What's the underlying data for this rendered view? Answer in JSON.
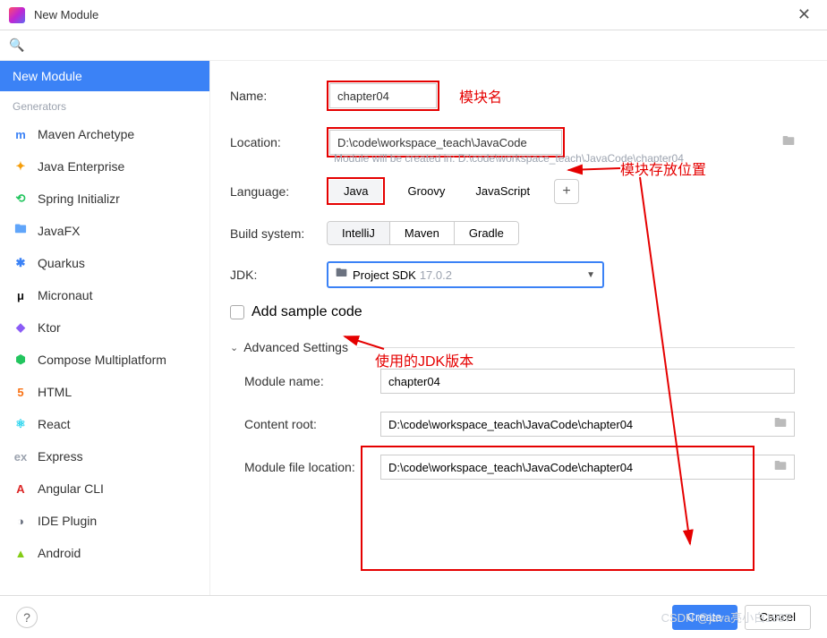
{
  "title": "New Module",
  "sidebar": {
    "new_module": "New Module",
    "generators_hdr": "Generators",
    "items": [
      {
        "label": "Maven Archetype",
        "color": "#3b82f6",
        "glyph": "m"
      },
      {
        "label": "Java Enterprise",
        "color": "#f59e0b",
        "glyph": "✦"
      },
      {
        "label": "Spring Initializr",
        "color": "#22c55e",
        "glyph": "⟲"
      },
      {
        "label": "JavaFX",
        "color": "#60a5fa",
        "glyph": "🖿"
      },
      {
        "label": "Quarkus",
        "color": "#3b82f6",
        "glyph": "✱"
      },
      {
        "label": "Micronaut",
        "color": "#111",
        "glyph": "μ"
      },
      {
        "label": "Ktor",
        "color": "#8b5cf6",
        "glyph": "◆"
      },
      {
        "label": "Compose Multiplatform",
        "color": "#22c55e",
        "glyph": "⬢"
      },
      {
        "label": "HTML",
        "color": "#f97316",
        "glyph": "5"
      },
      {
        "label": "React",
        "color": "#22d3ee",
        "glyph": "⚛"
      },
      {
        "label": "Express",
        "color": "#9ca3af",
        "glyph": "ex"
      },
      {
        "label": "Angular CLI",
        "color": "#dc2626",
        "glyph": "A"
      },
      {
        "label": "IDE Plugin",
        "color": "#6b7280",
        "glyph": "◑"
      },
      {
        "label": "Android",
        "color": "#84cc16",
        "glyph": "▲"
      }
    ]
  },
  "form": {
    "name_label": "Name:",
    "name_value": "chapter04",
    "location_label": "Location:",
    "location_value": "D:\\code\\workspace_teach\\JavaCode",
    "location_note": "Module will be created in: D:\\code\\workspace_teach\\JavaCode\\chapter04",
    "language_label": "Language:",
    "languages": [
      "Java",
      "Groovy",
      "JavaScript"
    ],
    "build_label": "Build system:",
    "builds": [
      "IntelliJ",
      "Maven",
      "Gradle"
    ],
    "jdk_label": "JDK:",
    "jdk_value": "Project SDK",
    "jdk_version": "17.0.2",
    "sample_label": "Add sample code",
    "adv_header": "Advanced Settings",
    "module_name_label": "Module name:",
    "module_name_value": "chapter04",
    "content_root_label": "Content root:",
    "content_root_value": "D:\\code\\workspace_teach\\JavaCode\\chapter04",
    "module_file_label": "Module file location:",
    "module_file_value": "D:\\code\\workspace_teach\\JavaCode\\chapter04"
  },
  "annotations": {
    "a1": "模块名",
    "a2": "模块存放位置",
    "a3": "使用的JDK版本"
  },
  "footer": {
    "create": "Create",
    "cancel": "Cancel"
  },
  "watermark": "CSDN @java亮小白1997"
}
